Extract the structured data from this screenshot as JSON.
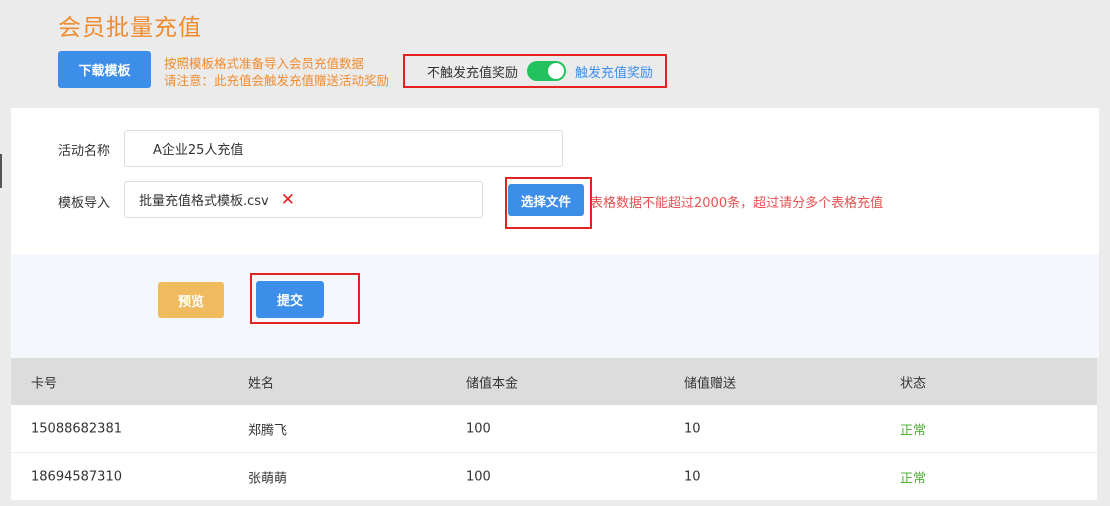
{
  "page": {
    "title": "会员批量充值"
  },
  "toolbar": {
    "download_label": "下载模板",
    "notice_line1": "按照模板格式准备导入会员充值数据",
    "notice_line2": "请注意：此充值会触发充值赠送活动奖励"
  },
  "reward_toggle": {
    "off_label": "不触发充值奖励",
    "on_label": "触发充值奖励",
    "checked": true
  },
  "form": {
    "activity_label": "活动名称",
    "activity_value": "A企业25人充值",
    "template_label": "模板导入",
    "file_name": "批量充值格式模板.csv",
    "choose_file_label": "选择文件",
    "limit_text": "表格数据不能超过2000条，超过请分多个表格充值"
  },
  "actions": {
    "preview_label": "预览",
    "submit_label": "提交"
  },
  "table": {
    "headers": [
      "卡号",
      "姓名",
      "储值本金",
      "储值赠送",
      "状态"
    ],
    "rows": [
      [
        "15088682381",
        "郑腾飞",
        "100",
        "10",
        "正常"
      ],
      [
        "18694587310",
        "张萌萌",
        "100",
        "10",
        "正常"
      ]
    ]
  },
  "colors": {
    "accent_blue": "#3d8ee9",
    "title_orange": "#f08c2e",
    "highlight_red": "#e52222",
    "status_green": "#4fb233",
    "toggle_green": "#22c35e"
  }
}
